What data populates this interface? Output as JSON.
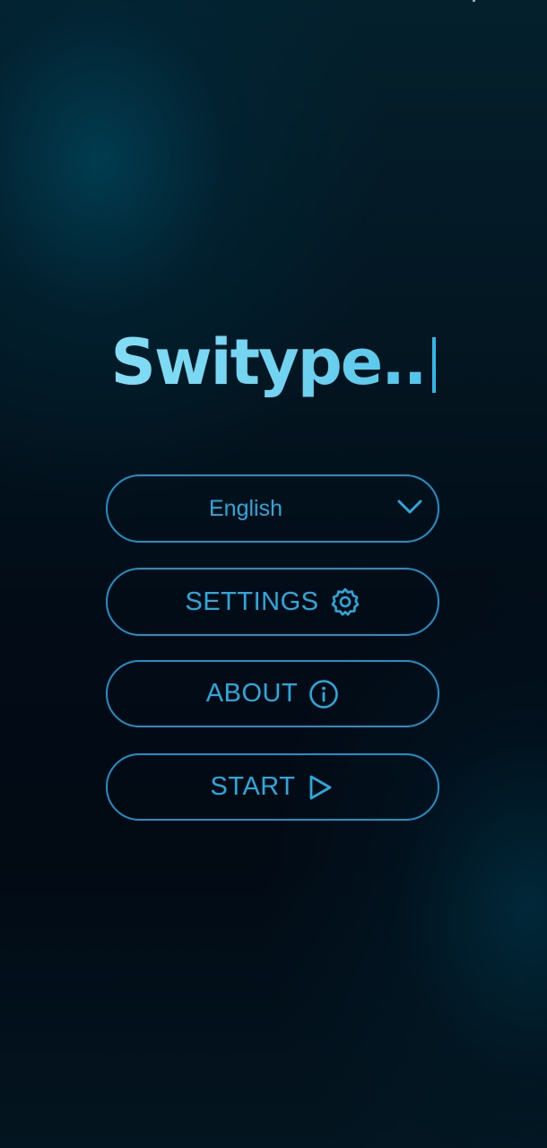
{
  "app": {
    "title": "Switype.."
  },
  "menu": {
    "language": {
      "selected": "English",
      "icon": "chevron-down-icon"
    },
    "settings": {
      "label": "SETTINGS",
      "icon": "gear-icon"
    },
    "about": {
      "label": "ABOUT",
      "icon": "info-icon"
    },
    "start": {
      "label": "START",
      "icon": "play-icon"
    }
  },
  "colors": {
    "accent": "#2aa9dc",
    "border": "#1f91c6",
    "title": "#7fdcf4",
    "background": "#020b16"
  }
}
